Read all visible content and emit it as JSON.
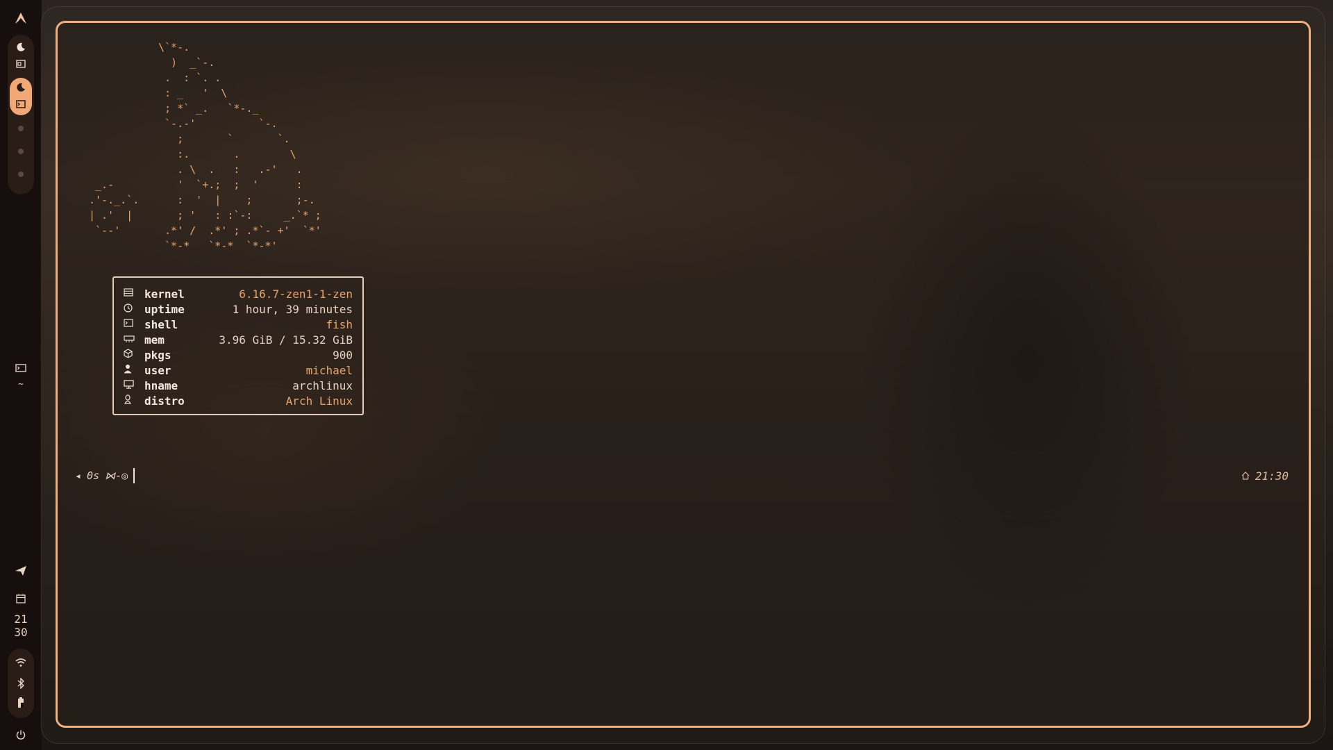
{
  "sidebar": {
    "launcher_icon": "arch-logo-icon",
    "workspaces": [
      {
        "icon": "moon-icon",
        "sub_icon": "window-icon",
        "active": false
      },
      {
        "icon": "moon-icon",
        "sub_icon": "terminal-icon",
        "active": true
      }
    ],
    "active_window_icon": "terminal-icon",
    "active_window_label": "~",
    "tray": {
      "send_icon": "send-icon",
      "calendar_icon": "calendar-icon",
      "clock_hour": "21",
      "clock_minute": "30",
      "wifi_icon": "wifi-icon",
      "bluetooth_icon": "bluetooth-icon",
      "battery_icon": "battery-icon",
      "power_icon": "power-icon"
    }
  },
  "terminal": {
    "ascii_art": "\\`*-.\n  )  _`-.\n .  : `. .\n : _   '  \\\n ; *` _.   `*-._\n `-.-'          `-.\n   ;       `       `.\n   :.       .        \\\n   . \\  .   :   .-'   .\n   '  `+.;  ;  '      :\n   :  '  |    ;       ;-.\n   ; '   : :`-:     _.`* ;\n .*' /  .*' ; .*`- +'  `*'\n `*-*   `*-*  `*-*'",
    "ascii_left_art": " _.-\n.'-._.`.\n| .'  |\n `--'",
    "info": [
      {
        "icon": "kernel-icon",
        "key": "kernel",
        "value": "6.16.7-zen1-1-zen",
        "color": "#e7a36c"
      },
      {
        "icon": "clock-icon",
        "key": "uptime",
        "value": "1 hour, 39 minutes",
        "color": "#e6d3c3"
      },
      {
        "icon": "terminal-icon",
        "key": "shell",
        "value": "fish",
        "color": "#e7a36c"
      },
      {
        "icon": "memory-icon",
        "key": "mem",
        "value": "3.96 GiB / 15.32 GiB",
        "color": "#e6d3c3"
      },
      {
        "icon": "package-icon",
        "key": "pkgs",
        "value": "900",
        "color": "#e6d3c3"
      },
      {
        "icon": "user-icon",
        "key": "user",
        "value": "michael",
        "color": "#e7a36c"
      },
      {
        "icon": "monitor-icon",
        "key": "hname",
        "value": "archlinux",
        "color": "#e6d3c3"
      },
      {
        "icon": "linux-icon",
        "key": "distro",
        "value": "Arch Linux",
        "color": "#e7a36c"
      }
    ],
    "prompt": {
      "arrow": "◂",
      "duration": "0s",
      "git_glyph": "⋈-◎",
      "right_icon": "home-icon",
      "right_time": "21:30"
    }
  },
  "colors": {
    "accent": "#efaf7f",
    "panel_bg": "#170f0d",
    "text": "#e6d3c3"
  }
}
